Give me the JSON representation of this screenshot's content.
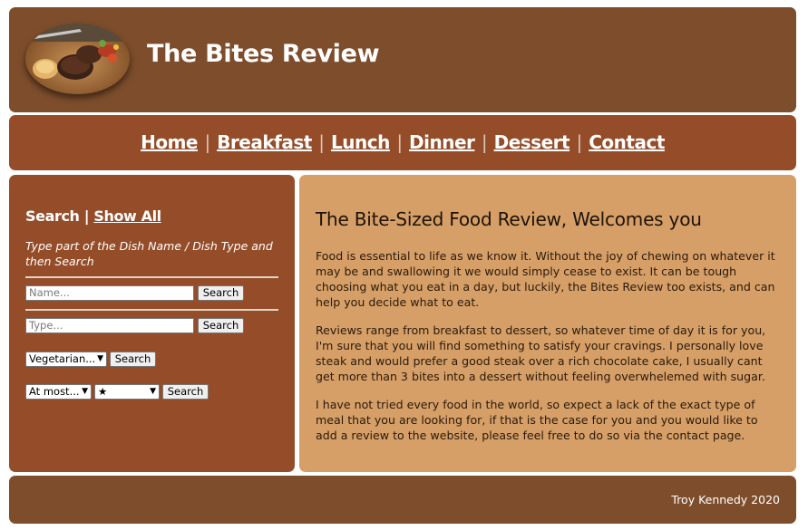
{
  "header": {
    "title": "The Bites Review",
    "logo": "steak-photo"
  },
  "nav": {
    "items": [
      "Home",
      "Breakfast",
      "Lunch",
      "Dinner",
      "Dessert",
      "Contact"
    ],
    "separator": "|"
  },
  "sidebar": {
    "search_label": "Search",
    "separator": "|",
    "show_all_label": "Show All",
    "hint": "Type part of the Dish Name / Dish Type and then Search",
    "name_placeholder": "Name...",
    "type_placeholder": "Type...",
    "search_button": "Search",
    "diet_select_value": "Vegetarian...",
    "price_select_value": "At most...",
    "rating_select_value": "★"
  },
  "main": {
    "heading": "The Bite-Sized Food Review, Welcomes you",
    "paragraphs": [
      "Food is essential to life as we know it. Without the joy of chewing on whatever it may be and swallowing it we would simply cease to exist. It can be tough choosing what you eat in a day, but luckily, the Bites Review too exists, and can help you decide what to eat.",
      "Reviews range from breakfast to dessert, so whatever time of day it is for you, I'm sure that you will find something to satisfy your cravings. I personally love steak and would prefer a good steak over a rich chocolate cake, I usually cant get more than 3 bites into a dessert without feeling overwhelemed with sugar.",
      "I have not tried every food in the world, so expect a lack of the exact type of meal that you are looking for, if that is the case for you and you would like to add a review to the website, please feel free to do so via the contact page."
    ]
  },
  "footer": {
    "copyright": "Troy Kennedy 2020"
  },
  "colors": {
    "header_bg": "#7e4e2c",
    "nav_bg": "#954d29",
    "sidebar_bg": "#954d29",
    "main_bg": "#d69f67",
    "footer_bg": "#7e4e2c"
  }
}
